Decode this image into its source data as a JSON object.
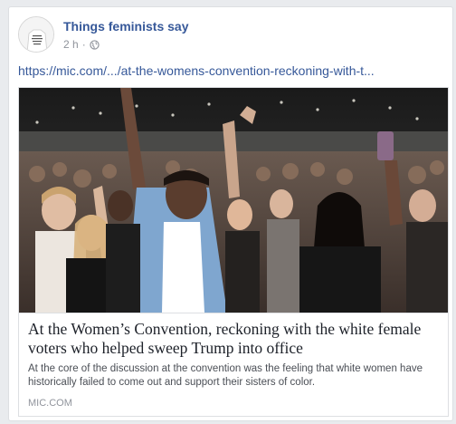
{
  "post": {
    "page_name": "Things feminists say",
    "time": "2 h",
    "separator": "·",
    "privacy_icon": "globe-icon",
    "link_url": "https://mic.com/.../at-the-womens-convention-reckoning-with-t...",
    "link_preview": {
      "image_description_icon": "photo",
      "headline": "At the Women’s Convention, reckoning with the white female voters who helped sweep Trump into office",
      "description": "At the core of the discussion at the convention was the feeling that white women have historically failed to come out and support their sisters of color.",
      "domain": "MIC.COM"
    }
  },
  "colors": {
    "link_blue": "#365899",
    "meta_gray": "#90949c",
    "text_dark": "#1d2129",
    "background": "#e9ebee"
  }
}
